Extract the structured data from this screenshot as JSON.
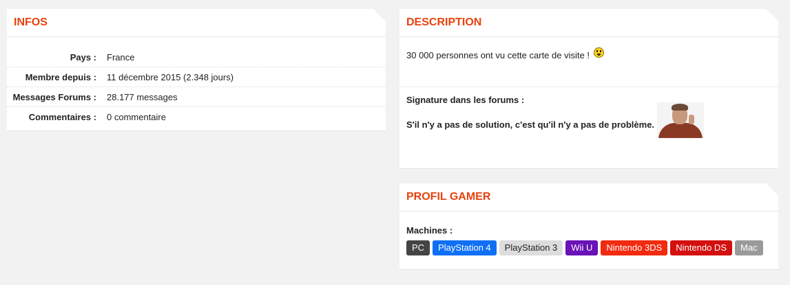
{
  "infos": {
    "title": "INFOS",
    "rows": [
      {
        "label": "Pays :",
        "value": "France"
      },
      {
        "label": "Membre depuis :",
        "value": "11 décembre 2015 (2.348 jours)"
      },
      {
        "label": "Messages Forums :",
        "value": "28.177 messages"
      },
      {
        "label": "Commentaires :",
        "value": "0 commentaire"
      }
    ]
  },
  "description": {
    "title": "DESCRIPTION",
    "text": "30 000 personnes ont vu cette carte de visite !",
    "signature_title": "Signature dans les forums :",
    "signature_text": "S'il n'y a pas de solution, c'est qu'il n'y a pas de problème."
  },
  "gamer": {
    "title": "PROFIL GAMER",
    "machines_label": "Machines :",
    "machines": [
      {
        "label": "PC",
        "color": "#444444",
        "text_color": "#ffffff"
      },
      {
        "label": "PlayStation 4",
        "color": "#0f6ff5",
        "text_color": "#ffffff"
      },
      {
        "label": "PlayStation 3",
        "color": "#dddddd",
        "text_color": "#222222"
      },
      {
        "label": "Wii U",
        "color": "#6a11b7",
        "text_color": "#ffffff"
      },
      {
        "label": "Nintendo 3DS",
        "color": "#f22a10",
        "text_color": "#ffffff"
      },
      {
        "label": "Nintendo DS",
        "color": "#d40f0f",
        "text_color": "#ffffff"
      },
      {
        "label": "Mac",
        "color": "#9a9a9a",
        "text_color": "#ffffff"
      }
    ]
  }
}
